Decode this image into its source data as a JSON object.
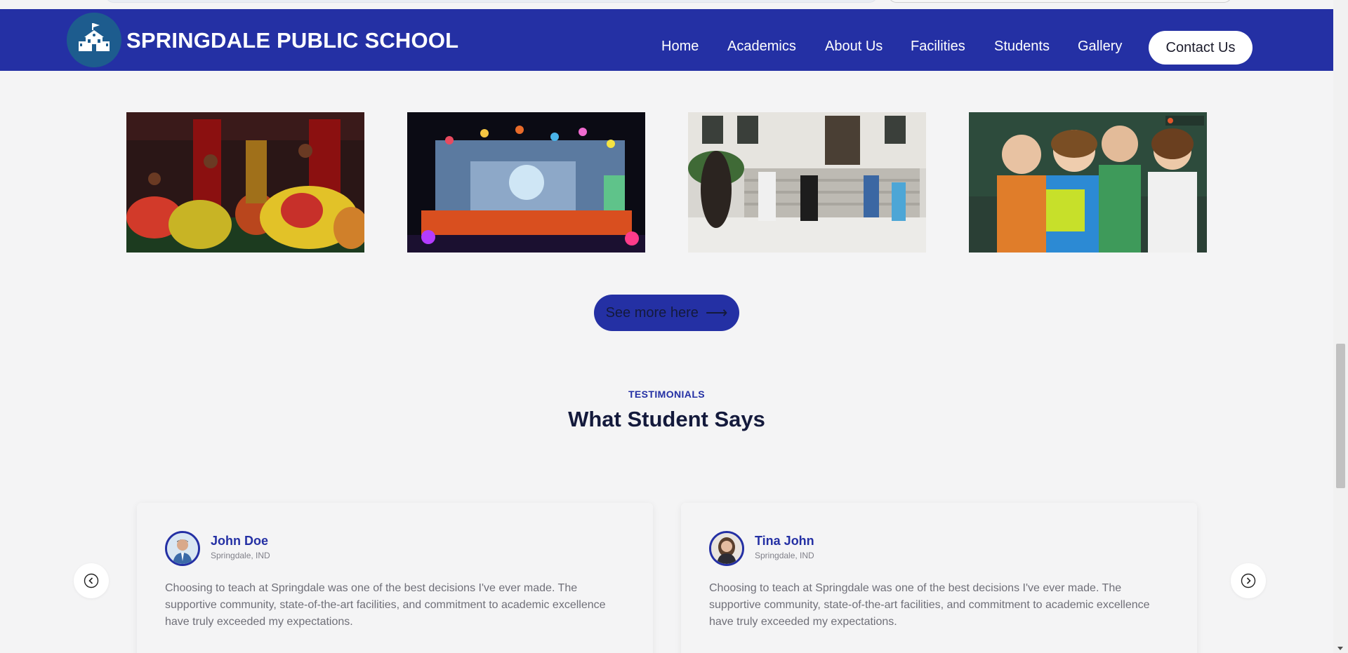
{
  "header": {
    "brand": "SPRINGDALE PUBLIC SCHOOL",
    "nav": [
      {
        "label": "Home"
      },
      {
        "label": "Academics"
      },
      {
        "label": "About Us"
      },
      {
        "label": "Facilities"
      },
      {
        "label": "Students"
      },
      {
        "label": "Gallery"
      }
    ],
    "contact_label": "Contact Us"
  },
  "gallery": {
    "images": [
      {
        "name": "dance-performance-image"
      },
      {
        "name": "stage-show-image"
      },
      {
        "name": "students-walking-image"
      },
      {
        "name": "students-group-image"
      }
    ],
    "see_more_label": "See more here",
    "see_more_arrow": "⟶"
  },
  "testimonials": {
    "eyebrow": "TESTIMONIALS",
    "title": "What Student Says",
    "items": [
      {
        "name": "John Doe",
        "location": "Springdale, IND",
        "text": "Choosing to teach at Springdale was one of the best decisions I've ever made. The supportive community, state-of-the-art facilities, and commitment to academic excellence have truly exceeded my expectations."
      },
      {
        "name": "Tina John",
        "location": "Springdale, IND",
        "text": "Choosing to teach at Springdale was one of the best decisions I've ever made. The supportive community, state-of-the-art facilities, and commitment to academic excellence have truly exceeded my expectations."
      }
    ]
  },
  "colors": {
    "brand_blue": "#2430a4",
    "dark_text": "#141a3c",
    "background": "#f4f4f5"
  }
}
